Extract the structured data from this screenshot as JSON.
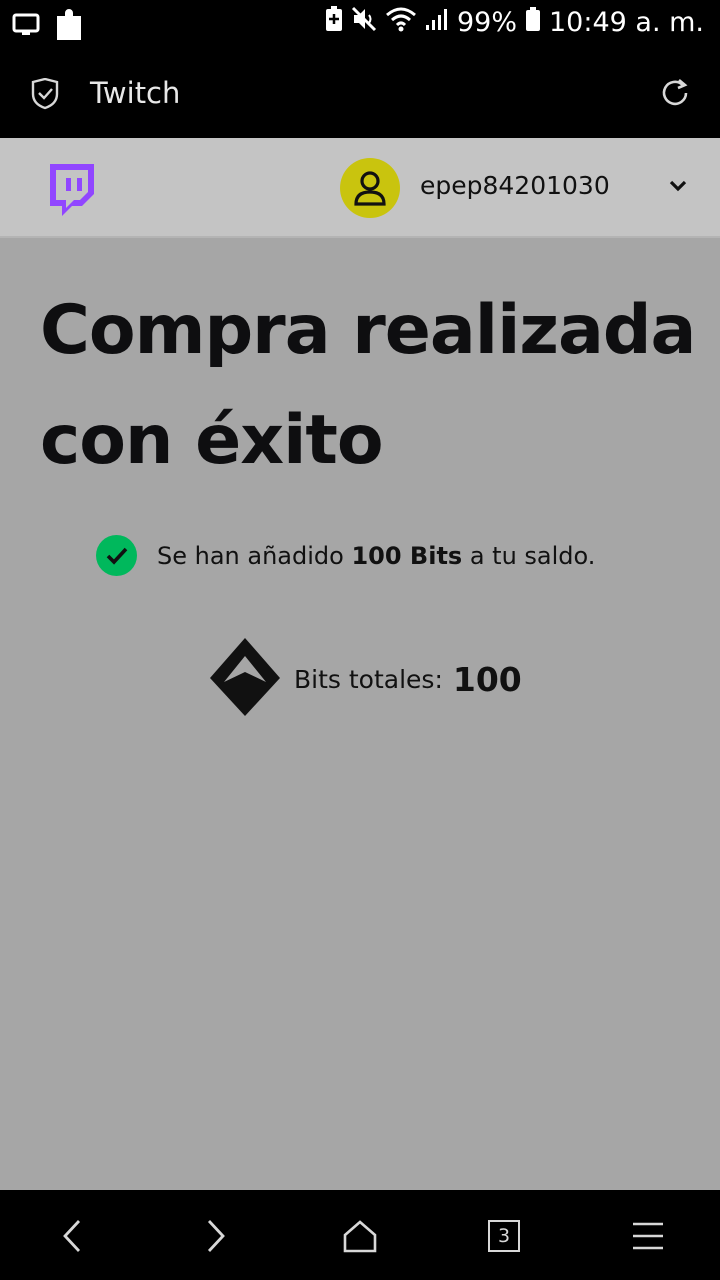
{
  "status_bar": {
    "battery": "99%",
    "time": "10:49 a. m."
  },
  "browser": {
    "title": "Twitch",
    "tab_count": "3"
  },
  "header": {
    "username": "epep84201030",
    "avatar_color": "#c9c40e",
    "brand_color": "#9146ff"
  },
  "main": {
    "title": "Compra realizada con éxito",
    "success_prefix": "Se han añadido ",
    "success_bold": "100 Bits",
    "success_suffix": " a tu saldo.",
    "bits_label": "Bits totales:",
    "bits_total": "100",
    "success_color": "#00b85c"
  }
}
